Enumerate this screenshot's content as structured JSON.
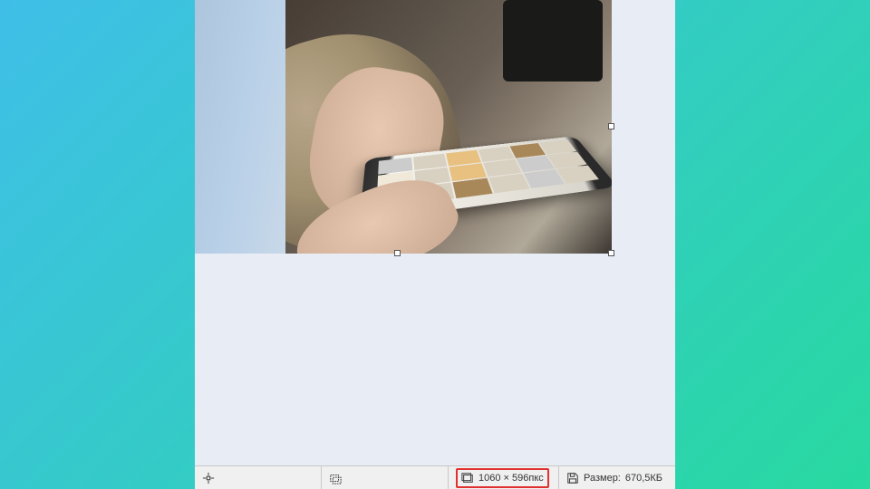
{
  "status": {
    "cursor_position": "",
    "selection_bounds": "",
    "dimensions_label": "1060 × 596пкс",
    "file_size_prefix": "Размер:",
    "file_size_value": "670,5КБ"
  },
  "icons": {
    "cursor": "cursor-position-icon",
    "selection": "selection-bounds-icon",
    "dimensions": "canvas-dimensions-icon",
    "save": "diskette-icon"
  }
}
